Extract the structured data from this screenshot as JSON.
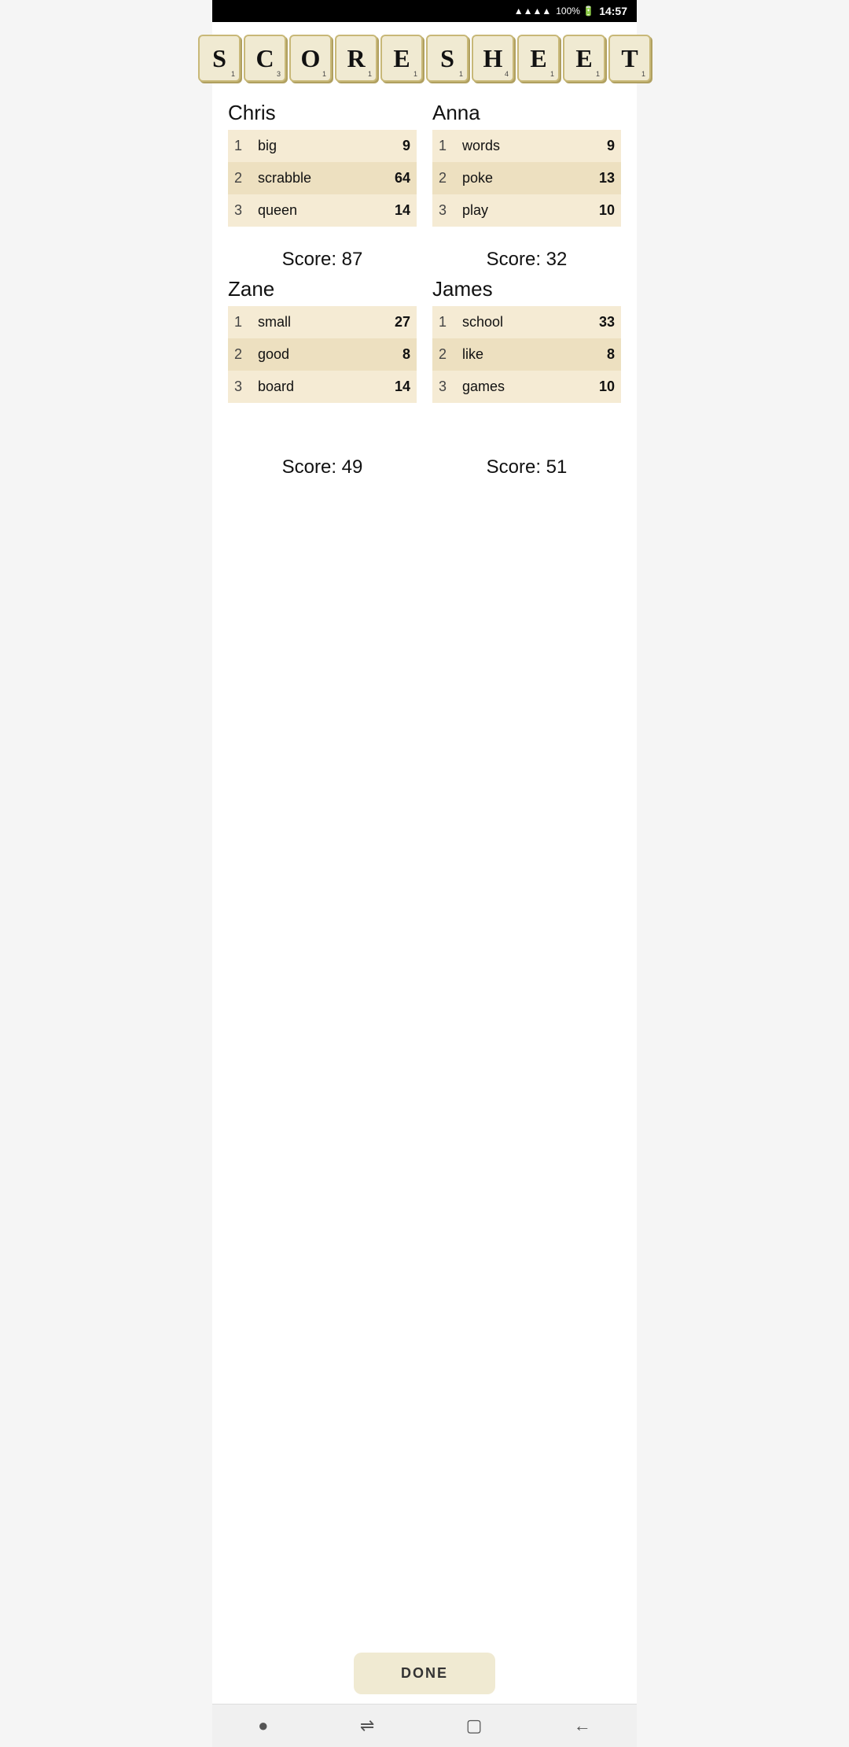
{
  "statusBar": {
    "signal": "▲▲▲▲",
    "battery": "100%",
    "batteryIcon": "🔋",
    "time": "14:57"
  },
  "title": {
    "letters": [
      {
        "char": "S",
        "num": "1"
      },
      {
        "char": "C",
        "num": "3"
      },
      {
        "char": "O",
        "num": "1"
      },
      {
        "char": "R",
        "num": "1"
      },
      {
        "char": "E",
        "num": "1"
      },
      {
        "char": "S",
        "num": "1"
      },
      {
        "char": "H",
        "num": "4"
      },
      {
        "char": "E",
        "num": "1"
      },
      {
        "char": "E",
        "num": "1"
      },
      {
        "char": "T",
        "num": "1"
      }
    ]
  },
  "players": [
    {
      "name": "Chris",
      "words": [
        {
          "num": 1,
          "word": "big",
          "score": 9
        },
        {
          "num": 2,
          "word": "scrabble",
          "score": 64
        },
        {
          "num": 3,
          "word": "queen",
          "score": 14
        }
      ],
      "total": "Score: 87"
    },
    {
      "name": "Anna",
      "words": [
        {
          "num": 1,
          "word": "words",
          "score": 9
        },
        {
          "num": 2,
          "word": "poke",
          "score": 13
        },
        {
          "num": 3,
          "word": "play",
          "score": 10
        }
      ],
      "total": "Score: 32"
    },
    {
      "name": "Zane",
      "words": [
        {
          "num": 1,
          "word": "small",
          "score": 27
        },
        {
          "num": 2,
          "word": "good",
          "score": 8
        },
        {
          "num": 3,
          "word": "board",
          "score": 14
        }
      ],
      "total": "Score: 49"
    },
    {
      "name": "James",
      "words": [
        {
          "num": 1,
          "word": "school",
          "score": 33
        },
        {
          "num": 2,
          "word": "like",
          "score": 8
        },
        {
          "num": 3,
          "word": "games",
          "score": 10
        }
      ],
      "total": "Score: 51"
    }
  ],
  "doneButton": "DONE",
  "nav": {
    "dot": "●",
    "lines": "⇌",
    "square": "▢",
    "back": "←"
  }
}
